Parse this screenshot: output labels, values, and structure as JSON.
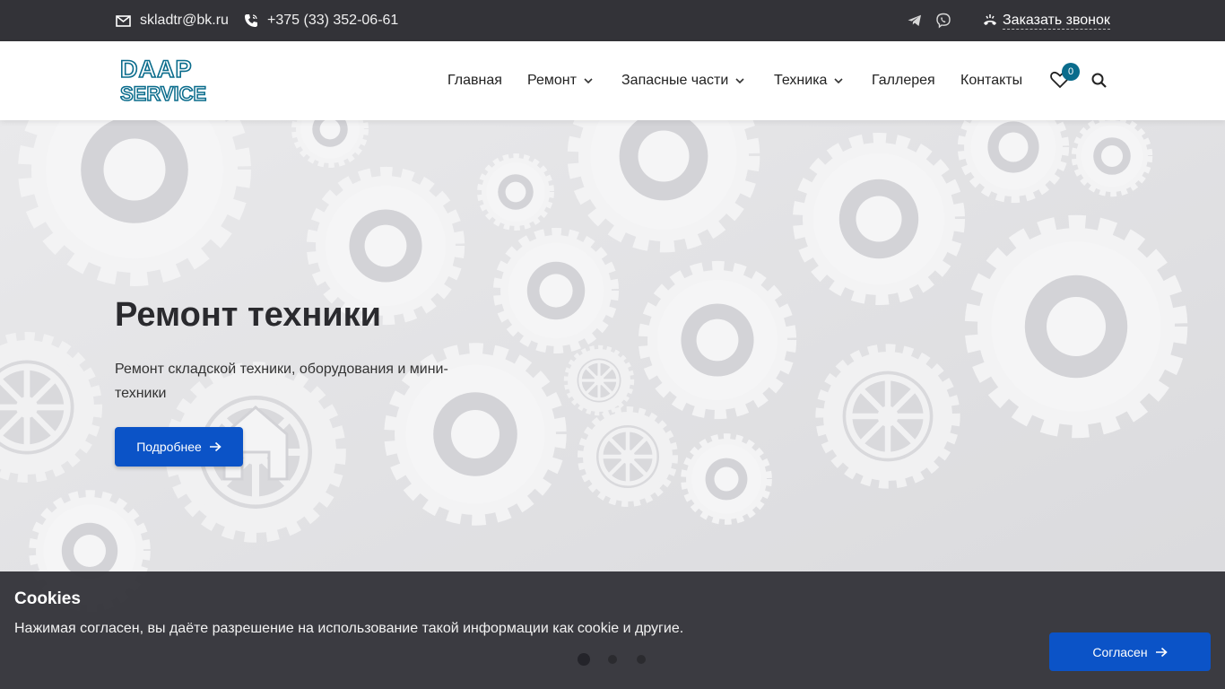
{
  "topbar": {
    "email": "skladtr@bk.ru",
    "phone": "+375 (33) 352-06-61",
    "callback_label": "Заказать звонок",
    "icons": [
      "mail-icon",
      "phone-icon",
      "telegram-icon",
      "viber-icon",
      "callback-icon"
    ]
  },
  "header": {
    "logo_line1": "DAAP",
    "logo_line2": "SERVICE",
    "nav": [
      {
        "label": "Главная",
        "dropdown": false
      },
      {
        "label": "Ремонт",
        "dropdown": true
      },
      {
        "label": "Запасные части",
        "dropdown": true
      },
      {
        "label": "Техника",
        "dropdown": true
      },
      {
        "label": "Галлерея",
        "dropdown": false
      },
      {
        "label": "Контакты",
        "dropdown": false
      }
    ],
    "wishlist_count": "0"
  },
  "hero": {
    "title": "Ремонт техники",
    "subtitle": "Ремонт складской техники, оборудования и мини-техники",
    "button_label": "Подробнее",
    "slides_total": 3,
    "active_slide": 1
  },
  "cookie": {
    "title": "Cookies",
    "text": "Нажимая согласен, вы даёте разрешение на использование такой информации как cookie и другие.",
    "button_label": "Согласен"
  },
  "colors": {
    "topbar_bg": "#333338",
    "accent_blue": "#0b53c7",
    "logo_teal": "#0a6c8c",
    "hero_bg": "#e4e4e6"
  }
}
